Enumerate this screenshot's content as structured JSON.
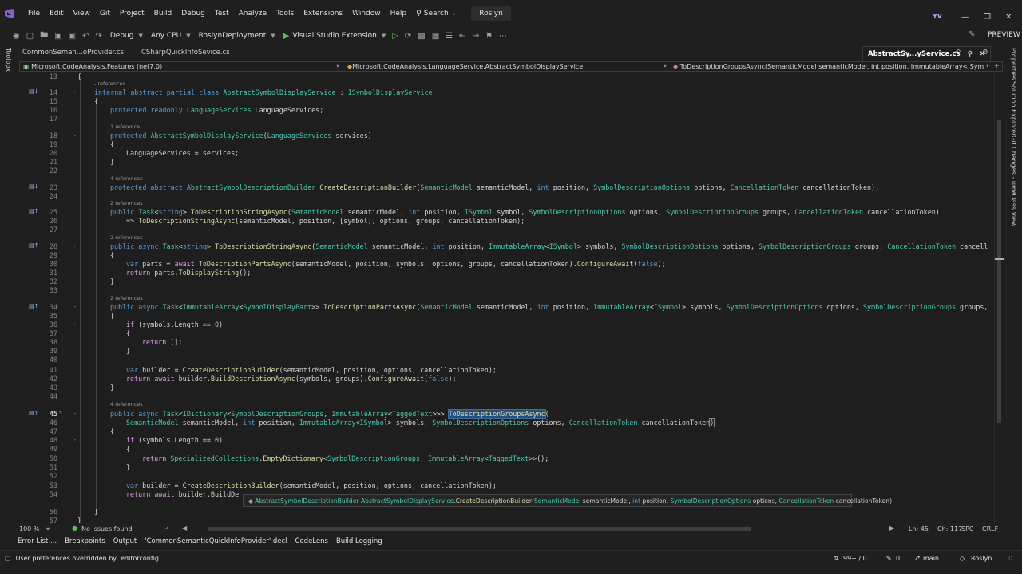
{
  "menu": {
    "items": [
      "File",
      "Edit",
      "View",
      "Git",
      "Project",
      "Build",
      "Debug",
      "Test",
      "Analyze",
      "Tools",
      "Extensions",
      "Window",
      "Help"
    ],
    "search_label": "Search",
    "solution_name": "Roslyn",
    "avatar": "YV"
  },
  "toolbar": {
    "config": "Debug",
    "platform": "Any CPU",
    "startup_project": "RoslynDeployment",
    "run_target": "Visual Studio Extension",
    "preview": "PREVIEW"
  },
  "side_panels": {
    "left": "Toolbox",
    "right": [
      "Properties",
      "Solution Explorer",
      "Git Changes - ume",
      "Class View"
    ]
  },
  "tabs": [
    {
      "label": "CommonSeman...oProvider.cs",
      "active": false
    },
    {
      "label": "CSharpQuickInfoSevice.cs",
      "active": false
    },
    {
      "label": "AbstractSy...yService.cs",
      "active": true
    }
  ],
  "navbar": {
    "project": "Microsoft.CodeAnalysis.Features (net7.0)",
    "type": "Microsoft.CodeAnalysis.LanguageService.AbstractSymbolDisplayService",
    "member": "ToDescriptionGroupsAsync(SemanticModel semanticModel, int position, ImmutableArray<ISymbol> symbol"
  },
  "code_lens": {
    "refs_none": "- references",
    "refs_1": "1 reference",
    "refs_2": "2 references",
    "refs_4": "4 references"
  },
  "tooltip": {
    "ret_type": "AbstractSymbolDescriptionBuilder",
    "owner": "AbstractSymbolDisplayService",
    "method": "CreateDescriptionBuilder",
    "p1_type": "SemanticModel",
    "p1_name": "semanticModel,",
    "p2_type": "int",
    "p2_name": "position,",
    "p3_type": "SymbolDescriptionOptions",
    "p3_name": "options,",
    "p4_type": "CancellationToken",
    "p4_name": "cancellationToken)"
  },
  "editor_status": {
    "zoom": "100 %",
    "issues": "No issues found",
    "ln": "Ln: 45",
    "ch": "Ch: 117",
    "ws": "SPC",
    "eol": "CRLF"
  },
  "tool_windows": [
    "Error List ...",
    "Breakpoints",
    "Output",
    "'CommonSemanticQuickInfoProvider' decl",
    "CodeLens",
    "Build Logging"
  ],
  "status_bar": {
    "message": "User preferences overridden by .editorconfig",
    "changes": "99+ / 0",
    "errors": "0",
    "branch": "main",
    "repo": "Roslyn"
  }
}
